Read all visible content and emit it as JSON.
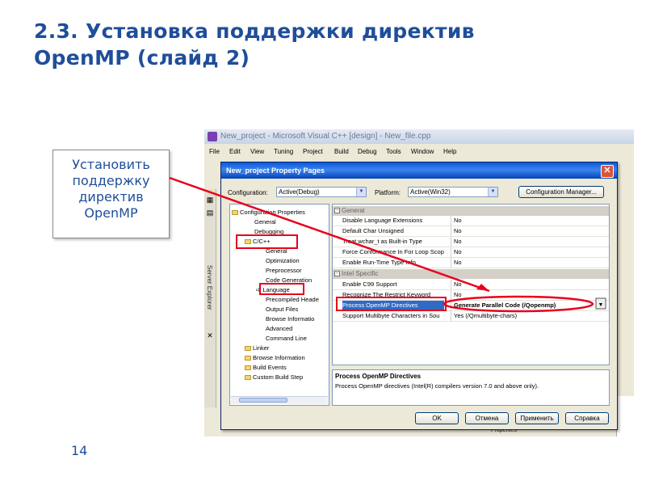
{
  "slide": {
    "title_line1": "2.3.  Установка поддержки директив",
    "title_line2": "OpenMP (слайд 2)",
    "callout_lines": [
      "Установить",
      "поддержку",
      "директив",
      "OpenMP"
    ],
    "page_number": "14"
  },
  "ide": {
    "window_title": "New_project - Microsoft Visual C++ [design] - New_file.cpp",
    "menu": [
      "File",
      "Edit",
      "View",
      "Tuning",
      "Project",
      "Build",
      "Debug",
      "Tools",
      "Window",
      "Help"
    ],
    "side_strip_label": "Server Explorer",
    "properties_label": "Properties"
  },
  "dialog": {
    "title": "New_project Property Pages",
    "close_glyph": "✕",
    "configuration_label": "Configuration:",
    "configuration_value": "Active(Debug)",
    "platform_label": "Platform:",
    "platform_value": "Active(Win32)",
    "config_manager_button": "Configuration Manager...",
    "dropdown_arrow": "▼",
    "tree": {
      "root": "Configuration Properties",
      "items": [
        "General",
        "Debugging",
        "C/C++",
        "General",
        "Optimization",
        "Preprocessor",
        "Code Generation",
        "Language",
        "Precompiled Heade",
        "Output Files",
        "Browse Informatio",
        "Advanced",
        "Command Line",
        "Linker",
        "Browse Information",
        "Build Events",
        "Custom Build Step"
      ]
    },
    "grid": {
      "category_general": "General",
      "category_intel": "Intel Specific",
      "rows_general": [
        {
          "name": "Disable Language Extensions",
          "value": "No"
        },
        {
          "name": "Default Char Unsigned",
          "value": "No"
        },
        {
          "name": "Treat wchar_t as Built-in Type",
          "value": "No"
        },
        {
          "name": "Force Conformance In For Loop Scop",
          "value": "No"
        },
        {
          "name": "Enable Run-Time Type Info",
          "value": "No"
        }
      ],
      "rows_intel": [
        {
          "name": "Enable C99 Support",
          "value": "No"
        },
        {
          "name": "Recognize The Restrict Keyword",
          "value": "No"
        },
        {
          "name": "Process OpenMP Directives",
          "value": "Generate Parallel Code (/Qopenmp)"
        },
        {
          "name": "Support Multibyte Characters in Sou",
          "value": "Yes (/Qmultibyte-chars)"
        }
      ]
    },
    "description": {
      "title": "Process OpenMP Directives",
      "text": "Process OpenMP directives (Intel(R) compilers version 7.0 and above only)."
    },
    "buttons": {
      "ok": "OK",
      "cancel": "Отмена",
      "apply": "Применить",
      "help": "Справка"
    }
  },
  "colors": {
    "title": "#1f4e9a",
    "annotation": "#e8001c",
    "dialog_titlebar": "#0a5bd8"
  }
}
